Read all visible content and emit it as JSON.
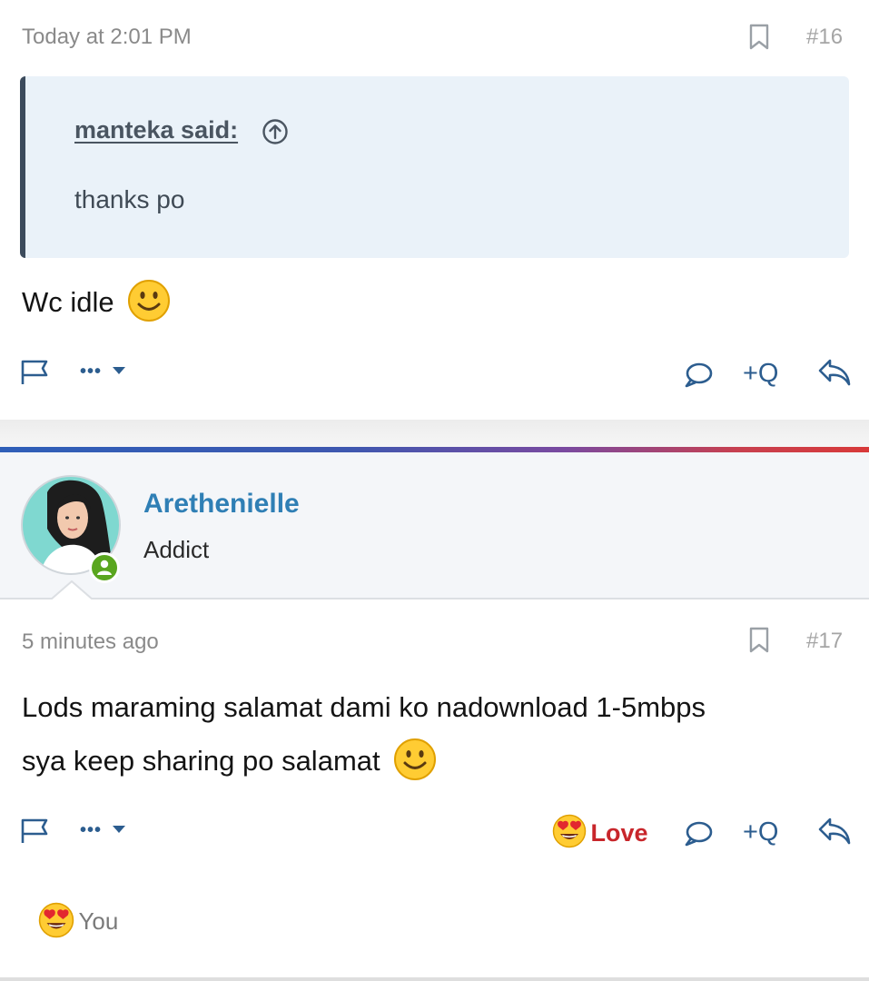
{
  "post16": {
    "timestamp": "Today at 2:01 PM",
    "number": "#16",
    "quote": {
      "author": "manteka said:",
      "text": "thanks po"
    },
    "message": "Wc idle",
    "actions": {
      "more": "•••",
      "multiquote": "+Q"
    }
  },
  "post17": {
    "user": {
      "name": "Arethenielle",
      "title": "Addict"
    },
    "timestamp": "5 minutes ago",
    "number": "#17",
    "message_line1": "Lods maraming salamat dami ko nadownload 1-5mbps",
    "message_line2": "sya keep sharing po salamat",
    "actions": {
      "more": "•••",
      "reaction_label": "Love",
      "multiquote": "+Q"
    },
    "reactions": {
      "by": "You"
    }
  },
  "colors": {
    "link": "#2c5d8f",
    "username": "#2f7fb5",
    "love": "#c8262b",
    "online": "#5aa61f"
  },
  "icons": [
    "bookmark-icon",
    "arrow-up-circle-icon",
    "smile-emoji",
    "flag-icon",
    "caret-down-icon",
    "comment-icon",
    "reply-icon",
    "heart-eyes-emoji",
    "online-status-icon",
    "avatar"
  ]
}
